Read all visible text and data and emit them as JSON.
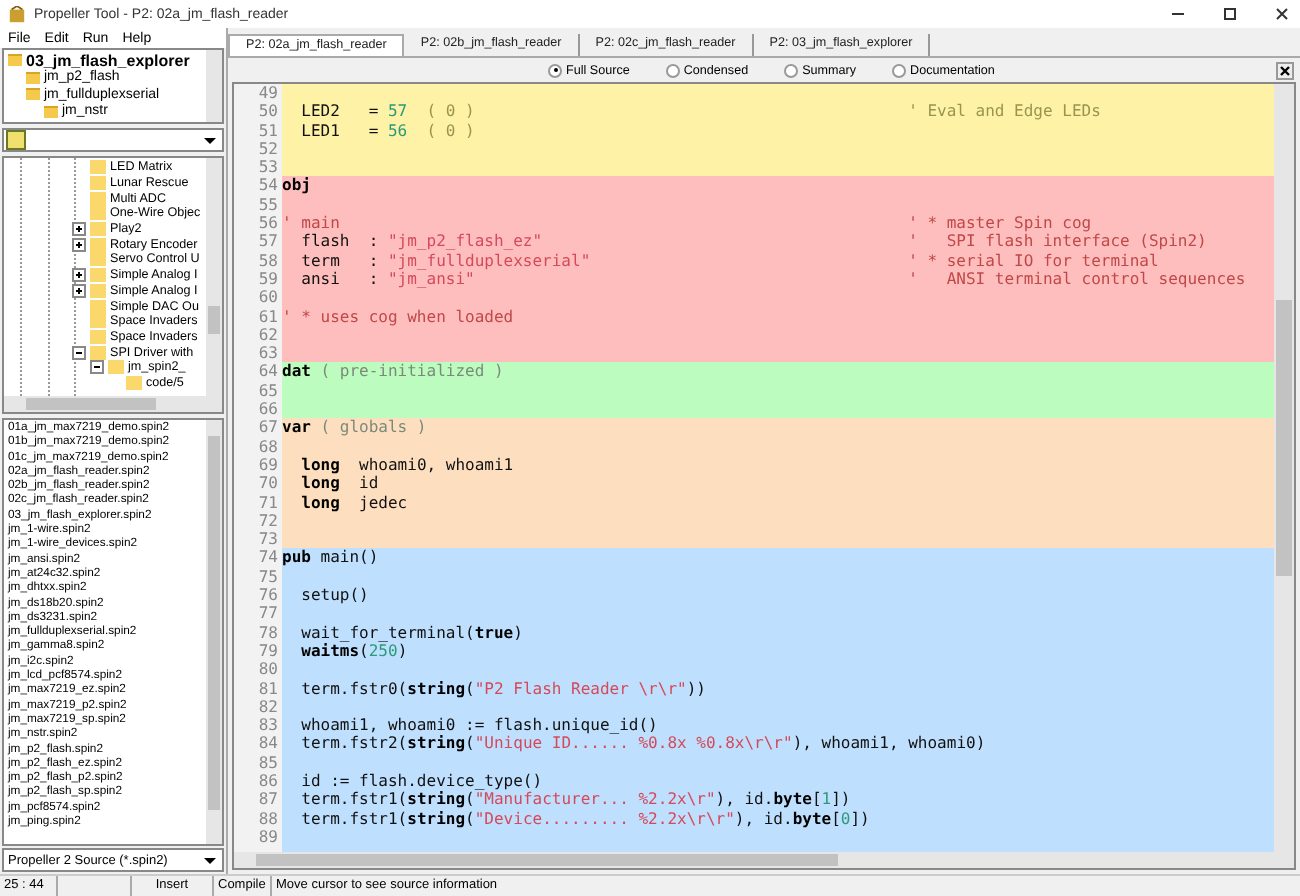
{
  "window": {
    "title": "Propeller Tool - P2: 02a_jm_flash_reader"
  },
  "menu": [
    "File",
    "Edit",
    "Run",
    "Help"
  ],
  "object_tree": {
    "label": "03_jm_flash_explorer",
    "children": [
      {
        "label": "jm_p2_flash"
      },
      {
        "label": "jm_fullduplexserial",
        "children": [
          {
            "label": "jm_nstr"
          }
        ]
      }
    ]
  },
  "folder_tree": [
    {
      "label": "LED Matrix",
      "kind": "leaf"
    },
    {
      "label": "Lunar Rescue",
      "kind": "leaf"
    },
    {
      "label": "Multi ADC",
      "kind": "leaf"
    },
    {
      "label": "One-Wire Objec",
      "kind": "leaf"
    },
    {
      "label": "Play2",
      "kind": "group",
      "expanded": false
    },
    {
      "label": "Rotary Encoder",
      "kind": "group",
      "expanded": false
    },
    {
      "label": "Servo Control U",
      "kind": "leaf"
    },
    {
      "label": "Simple Analog I",
      "kind": "group",
      "expanded": false
    },
    {
      "label": "Simple Analog I",
      "kind": "group",
      "expanded": false
    },
    {
      "label": "Simple DAC Ou",
      "kind": "leaf"
    },
    {
      "label": "Space Invaders",
      "kind": "leaf"
    },
    {
      "label": "Space Invaders",
      "kind": "leaf"
    },
    {
      "label": "SPI Driver with",
      "kind": "group",
      "expanded": true,
      "children": [
        {
          "label": "jm_spin2_",
          "kind": "group",
          "expanded": true,
          "children": [
            {
              "label": "code/5",
              "kind": "leaf"
            }
          ]
        }
      ]
    }
  ],
  "files": [
    {
      "name": "01a_jm_max7219_demo.spin2"
    },
    {
      "name": "01b_jm_max7219_demo.spin2"
    },
    {
      "name": "01c_jm_max7219_demo.spin2"
    },
    {
      "name": "02a_jm_flash_reader.spin2"
    },
    {
      "name": "02b_jm_flash_reader.spin2"
    },
    {
      "name": "02c_jm_flash_reader.spin2"
    },
    {
      "name": "03_jm_flash_explorer.spin2"
    },
    {
      "name": "jm_1-wire.spin2"
    },
    {
      "name": "jm_1-wire_devices.spin2"
    },
    {
      "name": "jm_ansi.spin2"
    },
    {
      "name": "jm_at24c32.spin2"
    },
    {
      "name": "jm_dhtxx.spin2"
    },
    {
      "name": "jm_ds18b20.spin2"
    },
    {
      "name": "jm_ds3231.spin2"
    },
    {
      "name": "jm_fullduplexserial.spin2"
    },
    {
      "name": "jm_gamma8.spin2"
    },
    {
      "name": "jm_i2c.spin2"
    },
    {
      "name": "jm_lcd_pcf8574.spin2"
    },
    {
      "name": "jm_max7219_ez.spin2"
    },
    {
      "name": "jm_max7219_p2.spin2"
    },
    {
      "name": "jm_max7219_sp.spin2"
    },
    {
      "name": "jm_nstr.spin2"
    },
    {
      "name": "jm_p2_flash.spin2"
    },
    {
      "name": "jm_p2_flash_ez.spin2"
    },
    {
      "name": "jm_p2_flash_p2.spin2"
    },
    {
      "name": "jm_p2_flash_sp.spin2"
    },
    {
      "name": "jm_pcf8574.spin2"
    },
    {
      "name": "jm_ping.spin2"
    }
  ],
  "file_filter": "Propeller 2 Source (*.spin2)",
  "tabs": [
    {
      "label": "P2: 02a_jm_flash_reader",
      "selected": true
    },
    {
      "label": "P2: 02b_jm_flash_reader",
      "selected": false
    },
    {
      "label": "P2: 02c_jm_flash_reader",
      "selected": false
    },
    {
      "label": "P2: 03_jm_flash_explorer",
      "selected": false
    }
  ],
  "views": [
    {
      "label": "Full Source",
      "selected": true
    },
    {
      "label": "Condensed",
      "selected": false
    },
    {
      "label": "Summary",
      "selected": false
    },
    {
      "label": "Documentation",
      "selected": false
    }
  ],
  "blocks": [
    {
      "kind": "con",
      "lines": [
        {
          "n": "49"
        },
        {
          "n": "50",
          "code": [
            {
              "kind": "plain",
              "text": "  LED2   = "
            },
            {
              "kind": "num",
              "text": "57"
            },
            {
              "kind": "comment",
              "text": "  ( 0 )"
            }
          ],
          "note": "' Eval and Edge LEDs"
        },
        {
          "n": "51",
          "code": [
            {
              "kind": "plain",
              "text": "  LED1   = "
            },
            {
              "kind": "num",
              "text": "56"
            },
            {
              "kind": "comment",
              "text": "  ( 0 )"
            }
          ]
        },
        {
          "n": "52"
        },
        {
          "n": "53"
        }
      ]
    },
    {
      "kind": "obj",
      "lines": [
        {
          "n": "54",
          "code": [
            {
              "kind": "kw",
              "text": "obj"
            }
          ]
        },
        {
          "n": "55"
        },
        {
          "n": "56",
          "code": [
            {
              "kind": "comment",
              "text": "' main"
            }
          ],
          "note": "' * master Spin cog"
        },
        {
          "n": "57",
          "code": [
            {
              "kind": "plain",
              "text": "  flash  : "
            },
            {
              "kind": "str",
              "text": "\"jm_p2_flash_ez\""
            }
          ],
          "note": "'   SPI flash interface (Spin2)"
        },
        {
          "n": "58",
          "code": [
            {
              "kind": "plain",
              "text": "  term   : "
            },
            {
              "kind": "str",
              "text": "\"jm_fullduplexserial\""
            }
          ],
          "note": "' * serial IO for terminal"
        },
        {
          "n": "59",
          "code": [
            {
              "kind": "plain",
              "text": "  ansi   : "
            },
            {
              "kind": "str",
              "text": "\"jm_ansi\""
            }
          ],
          "note": "'   ANSI terminal control sequences"
        },
        {
          "n": "60"
        },
        {
          "n": "61",
          "code": [
            {
              "kind": "comment",
              "text": "' * uses cog when loaded"
            }
          ]
        },
        {
          "n": "62"
        },
        {
          "n": "63"
        }
      ]
    },
    {
      "kind": "dat",
      "lines": [
        {
          "n": "64",
          "code": [
            {
              "kind": "kw",
              "text": "dat"
            },
            {
              "kind": "comment",
              "text": " ( pre-initialized )"
            }
          ]
        },
        {
          "n": "65"
        },
        {
          "n": "66"
        }
      ]
    },
    {
      "kind": "var",
      "lines": [
        {
          "n": "67",
          "code": [
            {
              "kind": "kw",
              "text": "var"
            },
            {
              "kind": "comment",
              "text": " ( globals )"
            }
          ]
        },
        {
          "n": "68"
        },
        {
          "n": "69",
          "code": [
            {
              "kind": "kw",
              "text": "  long"
            },
            {
              "kind": "plain",
              "text": "  whoami0, whoami1"
            }
          ]
        },
        {
          "n": "70",
          "code": [
            {
              "kind": "kw",
              "text": "  long"
            },
            {
              "kind": "plain",
              "text": "  id"
            }
          ]
        },
        {
          "n": "71",
          "code": [
            {
              "kind": "kw",
              "text": "  long"
            },
            {
              "kind": "plain",
              "text": "  jedec"
            }
          ]
        },
        {
          "n": "72"
        },
        {
          "n": "73"
        }
      ]
    },
    {
      "kind": "pub",
      "lines": [
        {
          "n": "74",
          "code": [
            {
              "kind": "kw",
              "text": "pub"
            },
            {
              "kind": "plain",
              "text": " main()"
            }
          ]
        },
        {
          "n": "75"
        },
        {
          "n": "76",
          "code": [
            {
              "kind": "plain",
              "text": "  setup()"
            }
          ]
        },
        {
          "n": "77"
        },
        {
          "n": "78",
          "code": [
            {
              "kind": "plain",
              "text": "  wait_for_terminal("
            },
            {
              "kind": "kw",
              "text": "true"
            },
            {
              "kind": "plain",
              "text": ")"
            }
          ]
        },
        {
          "n": "79",
          "code": [
            {
              "kind": "kw",
              "text": "  waitms"
            },
            {
              "kind": "plain",
              "text": "("
            },
            {
              "kind": "num",
              "text": "250"
            },
            {
              "kind": "plain",
              "text": ")"
            }
          ]
        },
        {
          "n": "80"
        },
        {
          "n": "81",
          "code": [
            {
              "kind": "plain",
              "text": "  term.fstr0("
            },
            {
              "kind": "kw",
              "text": "string"
            },
            {
              "kind": "plain",
              "text": "("
            },
            {
              "kind": "str",
              "text": "\"P2 Flash Reader \\r\\r\""
            },
            {
              "kind": "plain",
              "text": "))"
            }
          ]
        },
        {
          "n": "82"
        },
        {
          "n": "83",
          "code": [
            {
              "kind": "plain",
              "text": "  whoami1, whoami0 := flash.unique_id()"
            }
          ]
        },
        {
          "n": "84",
          "code": [
            {
              "kind": "plain",
              "text": "  term.fstr2("
            },
            {
              "kind": "kw",
              "text": "string"
            },
            {
              "kind": "plain",
              "text": "("
            },
            {
              "kind": "str",
              "text": "\"Unique ID...... %0.8x %0.8x\\r\\r\""
            },
            {
              "kind": "plain",
              "text": "), whoami1, whoami0)"
            }
          ]
        },
        {
          "n": "85"
        },
        {
          "n": "86",
          "code": [
            {
              "kind": "plain",
              "text": "  id := flash.device_type()"
            }
          ]
        },
        {
          "n": "87",
          "code": [
            {
              "kind": "plain",
              "text": "  term.fstr1("
            },
            {
              "kind": "kw",
              "text": "string"
            },
            {
              "kind": "plain",
              "text": "("
            },
            {
              "kind": "str",
              "text": "\"Manufacturer... %2.2x\\r\""
            },
            {
              "kind": "plain",
              "text": "), id."
            },
            {
              "kind": "kw",
              "text": "byte"
            },
            {
              "kind": "plain",
              "text": "["
            },
            {
              "kind": "num",
              "text": "1"
            },
            {
              "kind": "plain",
              "text": "])"
            }
          ]
        },
        {
          "n": "88",
          "code": [
            {
              "kind": "plain",
              "text": "  term.fstr1("
            },
            {
              "kind": "kw",
              "text": "string"
            },
            {
              "kind": "plain",
              "text": "("
            },
            {
              "kind": "str",
              "text": "\"Device......... %2.2x\\r\\r\""
            },
            {
              "kind": "plain",
              "text": "), id."
            },
            {
              "kind": "kw",
              "text": "byte"
            },
            {
              "kind": "plain",
              "text": "["
            },
            {
              "kind": "num",
              "text": "0"
            },
            {
              "kind": "plain",
              "text": "])"
            }
          ]
        },
        {
          "n": "89"
        }
      ]
    }
  ],
  "status_bar": {
    "position": "25 : 44",
    "mode": "Insert",
    "compile": "Compile",
    "message": "Move cursor to see source information"
  }
}
